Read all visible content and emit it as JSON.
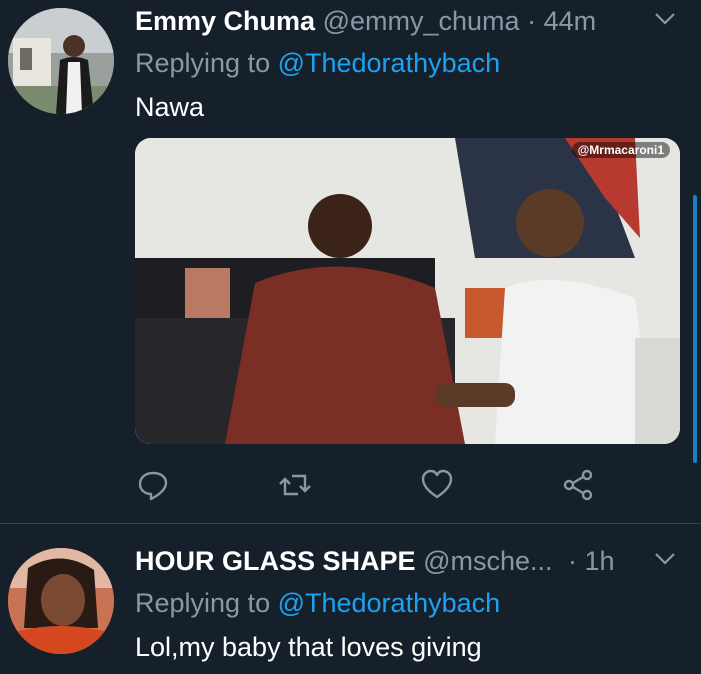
{
  "tweets": [
    {
      "name": "Emmy Chuma",
      "handle": "@emmy_chuma",
      "dot": "·",
      "time": "44m",
      "replying_prefix": "Replying to ",
      "replying_to": "@Thedorathybach",
      "text": "Nawa",
      "media": {
        "watermark": "@Mrmacaroni1"
      },
      "actions": [
        "reply-icon",
        "retweet-icon",
        "like-icon",
        "share-icon"
      ]
    },
    {
      "name": "HOUR GLASS SHAPE",
      "handle": "@msche...",
      "dot": "·",
      "time": "1h",
      "replying_prefix": "Replying to ",
      "replying_to": "@Thedorathybach",
      "text": "Lol,my baby that loves giving"
    }
  ],
  "colors": {
    "background": "#15202b",
    "link": "#1da1f2",
    "muted": "#8899a6",
    "divider": "#38444d"
  }
}
